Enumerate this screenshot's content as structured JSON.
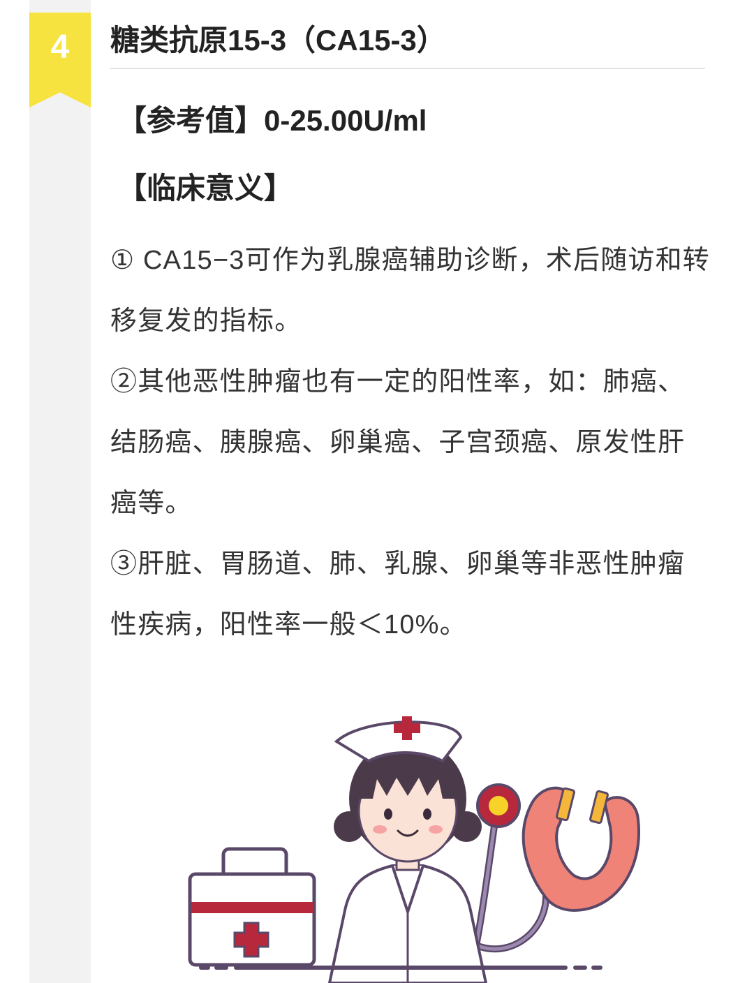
{
  "section": {
    "number": "4",
    "title": "糖类抗原15-3（CA15-3）"
  },
  "reference": {
    "text": "【参考值】0-25.00U/ml"
  },
  "clinical": {
    "heading": "【临床意义】",
    "points": [
      "① CA15−3可作为乳腺癌辅助诊断，术后随访和转移复发的指标。",
      "②其他恶性肿瘤也有一定的阳性率，如：肺癌、结肠癌、胰腺癌、卵巢癌、子宫颈癌、原发性肝癌等。",
      "③肝脏、胃肠道、肺、乳腺、卵巢等非恶性肿瘤性疾病，阳性率一般＜10%。"
    ]
  },
  "colors": {
    "badge": "#f7e33f",
    "strip": "#f2f2f2",
    "accent_red": "#b8283c",
    "outline_purple": "#5a4868",
    "stethoscope_pink": "#f08378"
  },
  "illustration": {
    "icons": [
      "nurse-icon",
      "first-aid-kit-icon",
      "stethoscope-icon"
    ]
  }
}
